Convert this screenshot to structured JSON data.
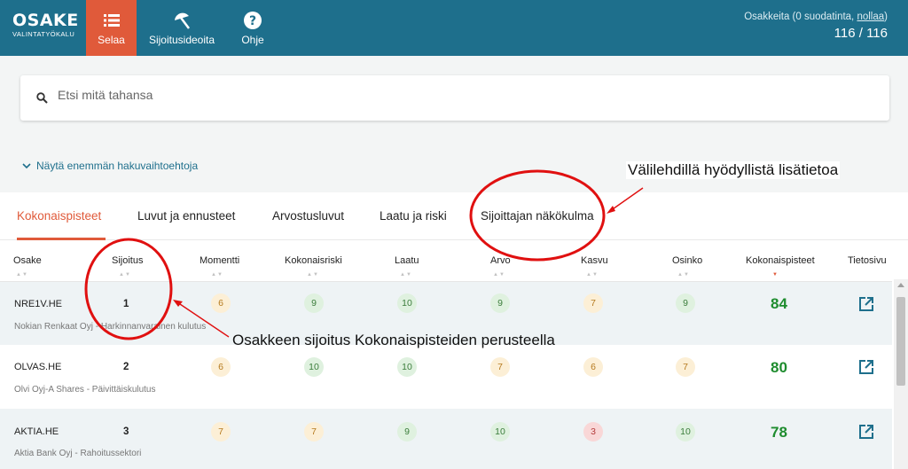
{
  "header": {
    "logo_main": "OSAKE",
    "logo_sub": "VALINTATYÖKALU",
    "nav": [
      {
        "label": "Selaa",
        "icon": "list-icon",
        "active": true
      },
      {
        "label": "Sijoitusideoita",
        "icon": "umbrella-icon",
        "active": false
      },
      {
        "label": "Ohje",
        "icon": "help-icon",
        "active": false
      }
    ],
    "counter_label": "Osakkeita (0 suodatinta, ",
    "counter_reset": "nollaa",
    "counter_close": ")",
    "counter_value": "116 / 116"
  },
  "search": {
    "placeholder": "Etsi mitä tahansa",
    "value": ""
  },
  "more_options": "Näytä enemmän hakuvaihtoehtoja",
  "tabs": [
    {
      "label": "Kokonaispisteet",
      "active": true
    },
    {
      "label": "Luvut ja ennusteet",
      "active": false
    },
    {
      "label": "Arvostusluvut",
      "active": false
    },
    {
      "label": "Laatu ja riski",
      "active": false
    },
    {
      "label": "Sijoittajan näkökulma",
      "active": false
    }
  ],
  "columns": [
    "Osake",
    "Sijoitus",
    "Momentti",
    "Kokonaisriski",
    "Laatu",
    "Arvo",
    "Kasvu",
    "Osinko",
    "Kokonaispisteet",
    "Tietosivu"
  ],
  "rows": [
    {
      "ticker": "NRE1V.HE",
      "company": "Nokian Renkaat Oyj - Harkinnanvarainen kulutus",
      "rank": "1",
      "scores": [
        {
          "v": "6",
          "c": "orange"
        },
        {
          "v": "9",
          "c": "green"
        },
        {
          "v": "10",
          "c": "green"
        },
        {
          "v": "9",
          "c": "green"
        },
        {
          "v": "7",
          "c": "orange"
        },
        {
          "v": "9",
          "c": "green"
        }
      ],
      "total": "84"
    },
    {
      "ticker": "OLVAS.HE",
      "company": "Olvi Oyj-A Shares - Päivittäiskulutus",
      "rank": "2",
      "scores": [
        {
          "v": "6",
          "c": "orange"
        },
        {
          "v": "10",
          "c": "green"
        },
        {
          "v": "10",
          "c": "green"
        },
        {
          "v": "7",
          "c": "orange"
        },
        {
          "v": "6",
          "c": "orange"
        },
        {
          "v": "7",
          "c": "orange"
        }
      ],
      "total": "80"
    },
    {
      "ticker": "AKTIA.HE",
      "company": "Aktia Bank Oyj - Rahoitussektori",
      "rank": "3",
      "scores": [
        {
          "v": "7",
          "c": "orange"
        },
        {
          "v": "7",
          "c": "orange"
        },
        {
          "v": "9",
          "c": "green"
        },
        {
          "v": "10",
          "c": "green"
        },
        {
          "v": "3",
          "c": "red"
        },
        {
          "v": "10",
          "c": "green"
        }
      ],
      "total": "78"
    }
  ],
  "annotations": {
    "tabs_note": "Välilehdillä hyödyllistä lisätietoa",
    "rank_note": "Osakkeen sijoitus Kokonaispisteiden perusteella"
  },
  "colors": {
    "header_bg": "#1e6f8c",
    "accent": "#e05a3a",
    "score_green": "#1e8c2e",
    "annotation_red": "#e01010"
  }
}
